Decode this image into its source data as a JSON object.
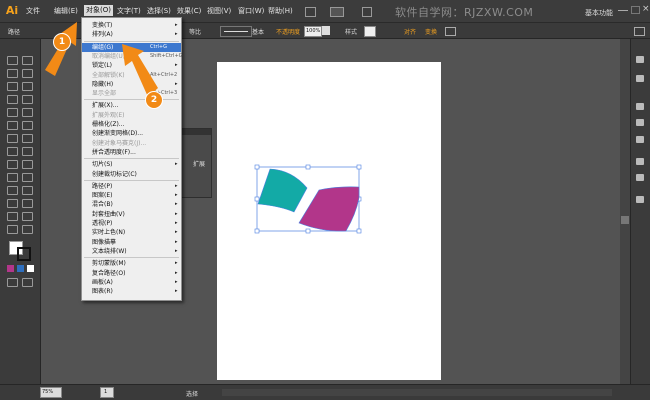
{
  "app": {
    "logo": "Ai"
  },
  "menubar": {
    "items": [
      "文件",
      "编辑(E)",
      "对象(O)",
      "文字(T)",
      "选择(S)",
      "效果(C)",
      "视图(V)",
      "窗口(W)",
      "帮助(H)"
    ],
    "watermark": "软件自学网：RJZXW.COM",
    "workspace": "基本功能"
  },
  "controlbar": {
    "label": "路径",
    "stroke_style": "等比",
    "basic": "基本",
    "opacity_label": "不透明度",
    "opacity_value": "100%",
    "style_label": "样式",
    "align_label": "对齐",
    "transform_label": "变换"
  },
  "menu": {
    "items": [
      {
        "label": "变换(T)",
        "shortcut": "",
        "arrow": true,
        "disabled": false,
        "highlighted": false
      },
      {
        "label": "排列(A)",
        "shortcut": "",
        "arrow": true,
        "disabled": false,
        "highlighted": false
      },
      {
        "label": "编组(G)",
        "shortcut": "Ctrl+G",
        "arrow": false,
        "disabled": false,
        "highlighted": true
      },
      {
        "label": "取消编组(U)",
        "shortcut": "Shift+Ctrl+G",
        "arrow": false,
        "disabled": true,
        "highlighted": false
      },
      {
        "label": "锁定(L)",
        "shortcut": "",
        "arrow": true,
        "disabled": false,
        "highlighted": false
      },
      {
        "label": "全部解锁(K)",
        "shortcut": "Alt+Ctrl+2",
        "arrow": false,
        "disabled": true,
        "highlighted": false
      },
      {
        "label": "隐藏(H)",
        "shortcut": "",
        "arrow": true,
        "disabled": false,
        "highlighted": false
      },
      {
        "label": "显示全部",
        "shortcut": "Alt+Ctrl+3",
        "arrow": false,
        "disabled": true,
        "highlighted": false
      },
      {
        "label": "扩展(X)...",
        "shortcut": "",
        "arrow": false,
        "disabled": false,
        "highlighted": false
      },
      {
        "label": "扩展外观(E)",
        "shortcut": "",
        "arrow": false,
        "disabled": true,
        "highlighted": false
      },
      {
        "label": "栅格化(Z)...",
        "shortcut": "",
        "arrow": false,
        "disabled": false,
        "highlighted": false
      },
      {
        "label": "创建渐变网格(D)...",
        "shortcut": "",
        "arrow": false,
        "disabled": false,
        "highlighted": false
      },
      {
        "label": "创建对象马赛克(J)...",
        "shortcut": "",
        "arrow": false,
        "disabled": true,
        "highlighted": false
      },
      {
        "label": "拼合透明度(F)...",
        "shortcut": "",
        "arrow": false,
        "disabled": false,
        "highlighted": false
      },
      {
        "label": "切片(S)",
        "shortcut": "",
        "arrow": true,
        "disabled": false,
        "highlighted": false
      },
      {
        "label": "创建裁切标记(C)",
        "shortcut": "",
        "arrow": false,
        "disabled": false,
        "highlighted": false
      },
      {
        "label": "路径(P)",
        "shortcut": "",
        "arrow": true,
        "disabled": false,
        "highlighted": false
      },
      {
        "label": "图案(E)",
        "shortcut": "",
        "arrow": true,
        "disabled": false,
        "highlighted": false
      },
      {
        "label": "混合(B)",
        "shortcut": "",
        "arrow": true,
        "disabled": false,
        "highlighted": false
      },
      {
        "label": "封套扭曲(V)",
        "shortcut": "",
        "arrow": true,
        "disabled": false,
        "highlighted": false
      },
      {
        "label": "透视(P)",
        "shortcut": "",
        "arrow": true,
        "disabled": false,
        "highlighted": false
      },
      {
        "label": "实时上色(N)",
        "shortcut": "",
        "arrow": true,
        "disabled": false,
        "highlighted": false
      },
      {
        "label": "图像描摹",
        "shortcut": "",
        "arrow": true,
        "disabled": false,
        "highlighted": false
      },
      {
        "label": "文本绕排(W)",
        "shortcut": "",
        "arrow": true,
        "disabled": false,
        "highlighted": false
      },
      {
        "label": "剪切蒙版(M)",
        "shortcut": "",
        "arrow": true,
        "disabled": false,
        "highlighted": false
      },
      {
        "label": "复合路径(O)",
        "shortcut": "",
        "arrow": true,
        "disabled": false,
        "highlighted": false
      },
      {
        "label": "画板(A)",
        "shortcut": "",
        "arrow": true,
        "disabled": false,
        "highlighted": false
      },
      {
        "label": "图表(R)",
        "shortcut": "",
        "arrow": true,
        "disabled": false,
        "highlighted": false
      }
    ]
  },
  "annotations": {
    "step1": "1",
    "step2": "2"
  },
  "floating_panel": {
    "label": "扩展"
  },
  "status": {
    "zoom": "75%",
    "page": "1",
    "tool": "选择"
  },
  "colors": {
    "teal": "#13aaa6",
    "magenta": "#b2368a",
    "orange": "#f28a16",
    "highlight": "#3d78cf"
  }
}
